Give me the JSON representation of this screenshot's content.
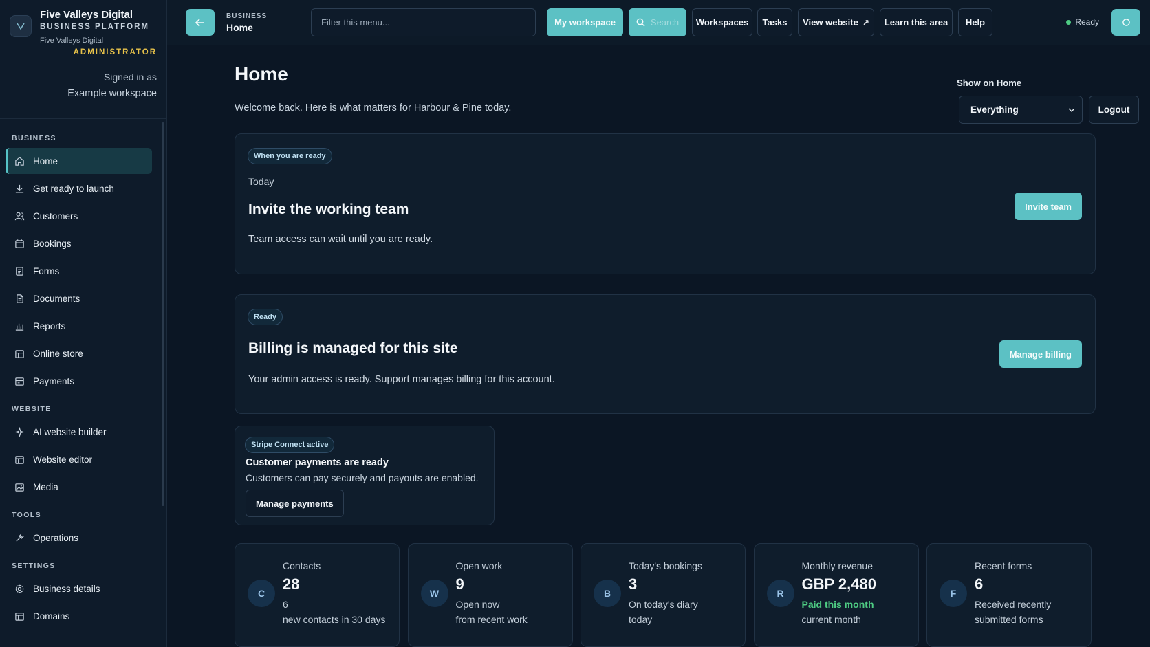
{
  "brand": {
    "name": "Five Valleys Digital",
    "platform": "BUSINESS PLATFORM",
    "sub": "Five Valleys Digital",
    "role": "ADMINISTRATOR",
    "signed_label": "Signed in as",
    "workspace": "Example workspace"
  },
  "sidebar": {
    "sections": [
      {
        "title": "BUSINESS",
        "items": [
          {
            "label": "Home",
            "icon": "home-icon",
            "active": true
          },
          {
            "label": "Get ready to launch",
            "icon": "download-icon"
          },
          {
            "label": "Customers",
            "icon": "users-icon"
          },
          {
            "label": "Bookings",
            "icon": "calendar-icon"
          },
          {
            "label": "Forms",
            "icon": "form-icon"
          },
          {
            "label": "Documents",
            "icon": "document-icon"
          },
          {
            "label": "Reports",
            "icon": "chart-icon"
          },
          {
            "label": "Online store",
            "icon": "store-icon"
          },
          {
            "label": "Payments",
            "icon": "payment-icon"
          }
        ]
      },
      {
        "title": "WEBSITE",
        "items": [
          {
            "label": "AI website builder",
            "icon": "sparkle-icon"
          },
          {
            "label": "Website editor",
            "icon": "layout-icon"
          },
          {
            "label": "Media",
            "icon": "image-icon"
          }
        ]
      },
      {
        "title": "TOOLS",
        "items": [
          {
            "label": "Operations",
            "icon": "tools-icon"
          }
        ]
      },
      {
        "title": "SETTINGS",
        "items": [
          {
            "label": "Business details",
            "icon": "gear-icon"
          },
          {
            "label": "Domains",
            "icon": "layout-icon"
          }
        ]
      }
    ]
  },
  "topbar": {
    "crumb_section": "BUSINESS",
    "crumb_page": "Home",
    "filter_placeholder": "Filter this menu...",
    "my_workspace": "My workspace",
    "search": "Search",
    "workspaces": "Workspaces",
    "tasks": "Tasks",
    "view_website": "View website",
    "learn": "Learn this area",
    "help": "Help",
    "status": "Ready"
  },
  "main": {
    "title": "Home",
    "subtitle": "Welcome back. Here is what matters for Harbour & Pine today.",
    "show_label": "Show on Home",
    "show_value": "Everything",
    "logout": "Logout"
  },
  "cards": {
    "invite": {
      "pill": "When you are ready",
      "meta": "Today",
      "title": "Invite the working team",
      "text": "Team access can wait until you are ready.",
      "button": "Invite team"
    },
    "billing": {
      "pill": "Ready",
      "title": "Billing is managed for this site",
      "text": "Your admin access is ready. Support manages billing for this account.",
      "button": "Manage billing"
    },
    "payments": {
      "pill": "Stripe Connect active",
      "title": "Customer payments are ready",
      "text": "Customers can pay securely and payouts are enabled.",
      "button": "Manage payments"
    }
  },
  "stats": [
    {
      "avatar": "C",
      "label": "Contacts",
      "value": "28",
      "sub1": "6",
      "sub2": "new contacts in 30 days",
      "green": false
    },
    {
      "avatar": "W",
      "label": "Open work",
      "value": "9",
      "sub1": "Open now",
      "sub2": "from recent work",
      "green": false
    },
    {
      "avatar": "B",
      "label": "Today's bookings",
      "value": "3",
      "sub1": "On today's diary",
      "sub2": "today",
      "green": false
    },
    {
      "avatar": "R",
      "label": "Monthly revenue",
      "value": "GBP 2,480",
      "sub1": "Paid this month",
      "sub2": "current month",
      "green": true
    },
    {
      "avatar": "F",
      "label": "Recent forms",
      "value": "6",
      "sub1": "Received recently",
      "sub2": "submitted forms",
      "green": false
    }
  ],
  "colors": {
    "accent": "#5cc1c4",
    "background": "#0b1624",
    "success": "#4ecb83",
    "role": "#e7c24a"
  }
}
